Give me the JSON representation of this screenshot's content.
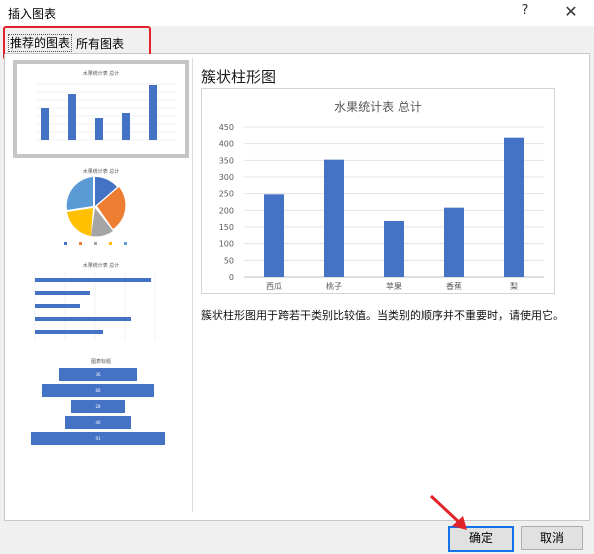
{
  "dialog": {
    "title": "插入图表",
    "help_label": "?",
    "close_label": "✕"
  },
  "tabs": [
    {
      "label": "推荐的图表",
      "active": true
    },
    {
      "label": "所有图表",
      "active": false
    }
  ],
  "thumbnails": [
    {
      "kind": "clustered-column",
      "title": "水果统计表 总计",
      "selected": true
    },
    {
      "kind": "pie",
      "title": "水果统计表 总计",
      "selected": false
    },
    {
      "kind": "clustered-bar",
      "title": "水果统计表 总计",
      "selected": false
    },
    {
      "kind": "funnel",
      "title": "图表标题",
      "selected": false
    }
  ],
  "preview": {
    "type_name": "簇状柱形图",
    "description": "簇状柱形图用于跨若干类别比较值。当类别的顺序并不重要时，请使用它。"
  },
  "chart_data": {
    "type": "bar",
    "title": "水果统计表 总计",
    "categories": [
      "西瓜",
      "桃子",
      "苹果",
      "香蕉",
      "梨"
    ],
    "values": [
      248,
      352,
      168,
      208,
      418
    ],
    "ylim": [
      0,
      450
    ],
    "yticks": [
      0,
      50,
      100,
      150,
      200,
      250,
      300,
      350,
      400,
      450
    ],
    "grid": true,
    "color": "#4472c4"
  },
  "funnel_values": [
    "36",
    "66",
    "28",
    "40",
    "91"
  ],
  "buttons": {
    "ok": "确定",
    "cancel": "取消"
  },
  "colors": {
    "accent": "#1473e6",
    "annotation": "#e3232b",
    "bar": "#4472c4"
  }
}
